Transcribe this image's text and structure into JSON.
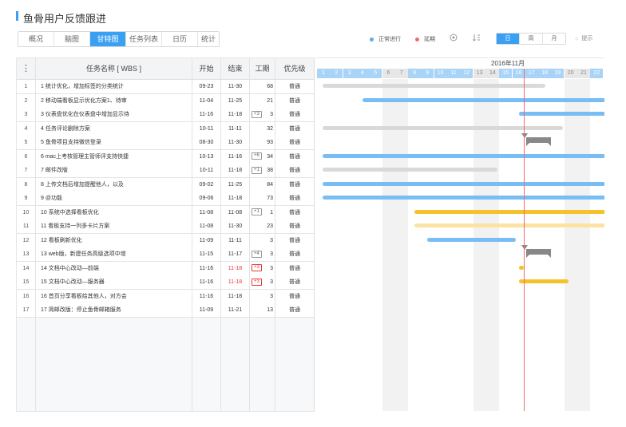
{
  "page": {
    "title": "鱼骨用户反馈跟进"
  },
  "tabs": [
    "概况",
    "脑图",
    "甘特图",
    "任务列表",
    "日历",
    "统计"
  ],
  "active_tab": 2,
  "legend": [
    {
      "label": "正常进行",
      "color": "#5aaaf0"
    },
    {
      "label": "延期",
      "color": "#f06a6a"
    }
  ],
  "view_buttons": [
    "日",
    "周",
    "月"
  ],
  "active_view": 0,
  "hint": "提示",
  "grid": {
    "menu_icon": "⋮",
    "headers": {
      "name": "任务名称 [ WBS ]",
      "start": "开始",
      "end": "结束",
      "duration": "工期",
      "priority": "优先级"
    },
    "rows": [
      {
        "n": "1",
        "name": "1  统计优化，增加标签的分类统计",
        "start": "09-23",
        "end": "11-30",
        "late": false,
        "badge": "",
        "dur": "68",
        "pri": "普通"
      },
      {
        "n": "2",
        "name": "2  移动端看板显示优化方案1、待审",
        "start": "11-04",
        "end": "11-25",
        "late": false,
        "badge": "",
        "dur": "21",
        "pri": "普通"
      },
      {
        "n": "3",
        "name": "3  仪表盘优化在仪表盘中增加显示待",
        "start": "11-16",
        "end": "11-18",
        "late": false,
        "badge": "+3",
        "dur": "3",
        "pri": "普通"
      },
      {
        "n": "4",
        "name": "4  任务评论删除方案",
        "start": "10-11",
        "end": "11-11",
        "late": false,
        "badge": "",
        "dur": "32",
        "pri": "普通"
      },
      {
        "n": "5",
        "name": "5  鱼骨项目支持微信登录",
        "start": "08-30",
        "end": "11-30",
        "late": false,
        "badge": "",
        "dur": "93",
        "pri": "普通"
      },
      {
        "n": "6",
        "name": "6  mac上考核管理主管师评支持快捷",
        "start": "10-13",
        "end": "11-16",
        "late": false,
        "badge": "+6",
        "dur": "34",
        "pri": "普通"
      },
      {
        "n": "7",
        "name": "7  邮件改版",
        "start": "10-11",
        "end": "11-18",
        "late": false,
        "badge": "+1",
        "dur": "38",
        "pri": "普通"
      },
      {
        "n": "8",
        "name": "8  上传文档后增加提醒他人，以及",
        "start": "09-02",
        "end": "11-25",
        "late": false,
        "badge": "",
        "dur": "84",
        "pri": "普通"
      },
      {
        "n": "9",
        "name": "9  @功能",
        "start": "09-06",
        "end": "11-18",
        "late": false,
        "badge": "",
        "dur": "73",
        "pri": "普通"
      },
      {
        "n": "10",
        "name": "10  系统中选择看板优化",
        "start": "11-08",
        "end": "11-08",
        "late": false,
        "badge": "+1",
        "dur": "1",
        "pri": "普通"
      },
      {
        "n": "11",
        "name": "11  看板支持一列多卡片方案",
        "start": "11-08",
        "end": "11-30",
        "late": false,
        "badge": "",
        "dur": "23",
        "pri": "普通"
      },
      {
        "n": "12",
        "name": "12  看板刷新优化",
        "start": "11-09",
        "end": "11-11",
        "late": false,
        "badge": "",
        "dur": "3",
        "pri": "普通"
      },
      {
        "n": "13",
        "name": "13  web版，新建任务高级选项中增",
        "start": "11-15",
        "end": "11-17",
        "late": false,
        "badge": "+4",
        "dur": "3",
        "pri": "普通"
      },
      {
        "n": "14",
        "name": "14  文档中心改动—前端",
        "start": "11-16",
        "end": "11-18",
        "late": true,
        "badge": "+3",
        "dur": "3",
        "pri": "普通"
      },
      {
        "n": "15",
        "name": "15  文档中心改动—服务器",
        "start": "11-16",
        "end": "11-18",
        "late": true,
        "badge": "+3",
        "dur": "3",
        "pri": "普通"
      },
      {
        "n": "16",
        "name": "16  首页分享看板给其他人，对方会",
        "start": "11-16",
        "end": "11-18",
        "late": false,
        "badge": "",
        "dur": "3",
        "pri": "普通"
      },
      {
        "n": "17",
        "name": "17  简邮改版：停止鱼骨邮箱服务",
        "start": "11-09",
        "end": "11-21",
        "late": false,
        "badge": "",
        "dur": "13",
        "pri": "普通"
      }
    ]
  },
  "gantt": {
    "month_label": "2016年11月",
    "days": [
      "1",
      "2",
      "3",
      "4",
      "5",
      "6",
      "7",
      "8",
      "9",
      "10",
      "11",
      "12",
      "13",
      "14",
      "15",
      "16",
      "17",
      "18",
      "19",
      "20",
      "21",
      "22"
    ],
    "weekend_days": [
      6,
      7,
      13,
      14,
      20,
      21
    ],
    "bar_colors": {
      "gray": "#d9d9d9",
      "blue": "#79bdf5",
      "yellow": "#f6c22c",
      "light_yellow": "#fbe3a3"
    }
  }
}
